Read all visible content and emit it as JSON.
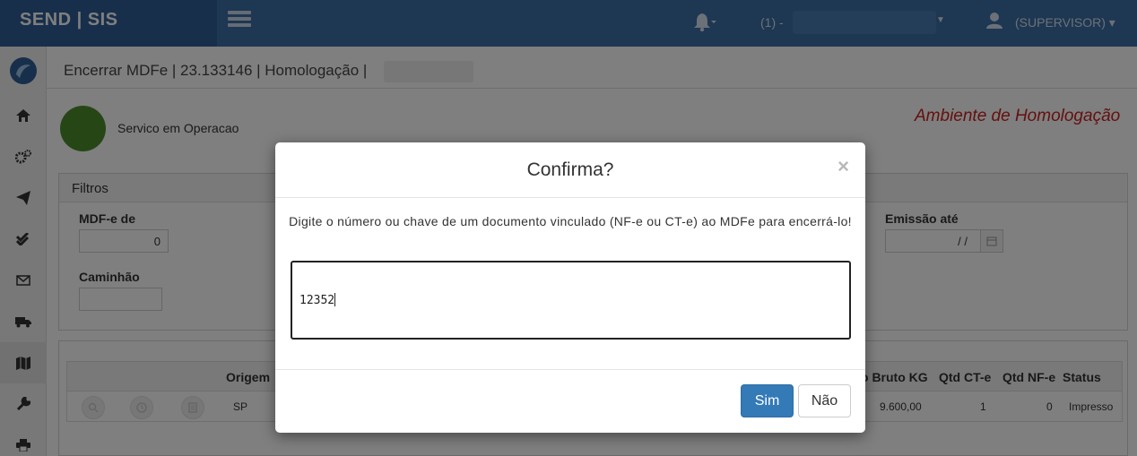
{
  "topbar": {
    "brand": "SEND | SIS",
    "company_prefix": "(1) -",
    "user_label": "(SUPERVISOR)",
    "brand_color": "#2f5f96",
    "bar_color": "#3c6ea5"
  },
  "sidebar": {
    "items": [
      {
        "icon": "logo-icon"
      },
      {
        "icon": "home-icon"
      },
      {
        "icon": "cogs-icon"
      },
      {
        "icon": "paper-plane-icon"
      },
      {
        "icon": "double-check-icon"
      },
      {
        "icon": "envelope-icon"
      },
      {
        "icon": "truck-icon"
      },
      {
        "icon": "map-icon",
        "active": true
      },
      {
        "icon": "wrench-icon"
      },
      {
        "icon": "print-icon"
      }
    ]
  },
  "page": {
    "title": "Encerrar MDFe | 23.133146 | Homologação |",
    "service_status": "Servico em Operacao",
    "service_status_color": "#4f8d2c",
    "environment": "Ambiente de Homologação",
    "environment_color": "#c9211e"
  },
  "filters": {
    "header": "Filtros",
    "mdfe_de_label": "MDF-e de",
    "mdfe_de_value": "0",
    "emissao_ate_label": "Emissão até",
    "emissao_ate_value": "/ /",
    "caminhao_label": "Caminhão",
    "caminhao_value": ""
  },
  "table": {
    "headers": {
      "origem": "Origem",
      "peso": "o Bruto KG",
      "qtd_cte": "Qtd CT-e",
      "qtd_nfe": "Qtd NF-e",
      "status": "Status"
    },
    "rows": [
      {
        "origem": "SP",
        "peso": "9.600,00",
        "qtd_cte": "1",
        "qtd_nfe": "0",
        "status": "Impresso"
      }
    ]
  },
  "modal": {
    "title": "Confirma?",
    "close": "×",
    "message": "Digite o número ou chave de um documento vinculado (NF-e ou CT-e) ao MDFe para encerrá-lo!",
    "input_value": "12352",
    "confirm_label": "Sim",
    "cancel_label": "Não",
    "confirm_color": "#337ab7"
  }
}
